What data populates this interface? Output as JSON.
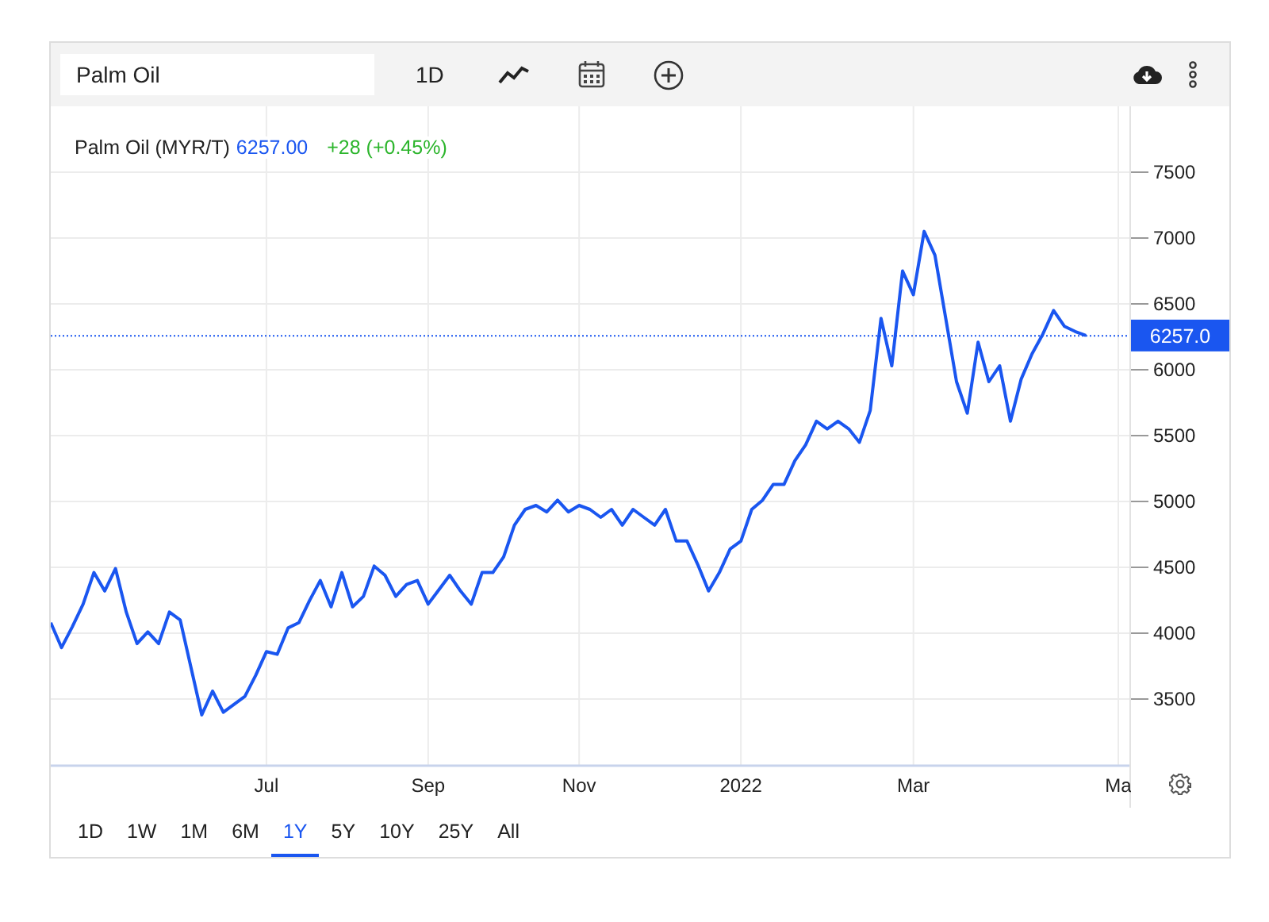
{
  "toolbar": {
    "search": {
      "value": "Palm Oil"
    },
    "interval": "1D"
  },
  "legend": {
    "price": "6257.00",
    "change": "+28 (+0.45%)"
  },
  "price_badge": "6257.0",
  "chart": {
    "chart_data": {
      "type": "line",
      "categories": [
        null,
        null,
        null,
        null,
        null,
        null,
        null,
        null,
        null,
        null,
        null,
        null,
        null,
        null,
        null,
        null,
        null,
        null,
        null,
        null,
        "Jul",
        null,
        null,
        null,
        null,
        null,
        null,
        null,
        null,
        null,
        null,
        null,
        null,
        null,
        null,
        "Sep",
        null,
        null,
        null,
        null,
        null,
        null,
        null,
        null,
        null,
        null,
        null,
        null,
        null,
        "Nov",
        null,
        null,
        null,
        null,
        null,
        null,
        null,
        null,
        null,
        null,
        null,
        null,
        null,
        null,
        "2022",
        null,
        null,
        null,
        null,
        null,
        null,
        null,
        null,
        null,
        null,
        null,
        null,
        null,
        null,
        null,
        "Mar",
        null,
        null,
        null,
        null,
        null,
        null,
        null,
        null,
        null,
        null,
        null,
        null,
        null,
        null,
        null,
        null,
        null,
        null,
        "Ma"
      ],
      "series": [
        {
          "name": "Palm Oil (MYR/T)",
          "color": "#1a56f0",
          "values": [
            4080,
            3890,
            4050,
            4220,
            4460,
            4320,
            4490,
            4160,
            3920,
            4010,
            3920,
            4160,
            4100,
            3740,
            3380,
            3560,
            3400,
            3460,
            3520,
            3680,
            3860,
            3840,
            4040,
            4080,
            4250,
            4400,
            4200,
            4460,
            4200,
            4280,
            4510,
            4440,
            4280,
            4370,
            4400,
            4220,
            4330,
            4440,
            4320,
            4220,
            4460,
            4460,
            4580,
            4820,
            4940,
            4970,
            4920,
            5010,
            4920,
            4970,
            4940,
            4880,
            4940,
            4820,
            4940,
            4880,
            4820,
            4940,
            4700,
            4700,
            4520,
            4320,
            4460,
            4640,
            4700,
            4940,
            5010,
            5130,
            5130,
            5310,
            5430,
            5610,
            5550,
            5610,
            5550,
            5450,
            5690,
            6390,
            6030,
            6750,
            6570,
            7050,
            6870,
            6390,
            5910,
            5670,
            6210,
            5910,
            6030,
            5610,
            5930,
            6120,
            6270,
            6450,
            6330,
            6290,
            6260,
            null,
            null,
            null
          ]
        }
      ],
      "ylim": [
        3000,
        8000
      ],
      "grid": true,
      "ref_lines": [
        {
          "axis": "y",
          "value": 6257
        }
      ],
      "yticks": [
        3500,
        4000,
        4500,
        5000,
        5500,
        6000,
        6500,
        7000,
        7500
      ]
    }
  },
  "ranges": [
    {
      "label": "1D",
      "selected": false
    },
    {
      "label": "1W",
      "selected": false
    },
    {
      "label": "1M",
      "selected": false
    },
    {
      "label": "6M",
      "selected": false
    },
    {
      "label": "1Y",
      "selected": true
    },
    {
      "label": "5Y",
      "selected": false
    },
    {
      "label": "10Y",
      "selected": false
    },
    {
      "label": "25Y",
      "selected": false
    },
    {
      "label": "All",
      "selected": false
    }
  ]
}
